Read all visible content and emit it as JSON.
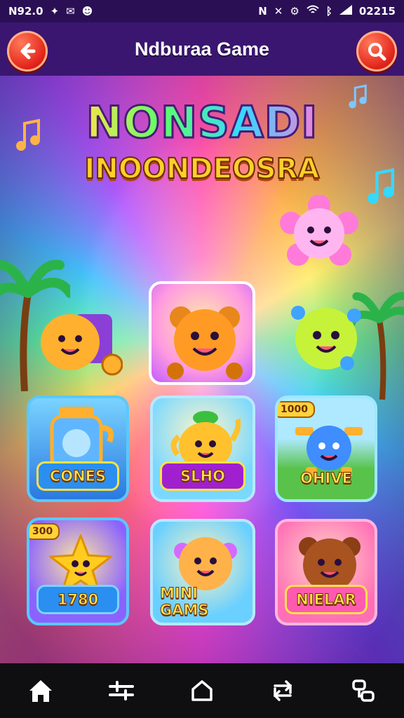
{
  "status_bar": {
    "time_left": "N92.0",
    "time_right": "02215"
  },
  "header": {
    "title": "Ndburaa Game"
  },
  "banner": {
    "line1": "NONSADI",
    "line2": "INOONDEOSRA"
  },
  "cards": [
    {
      "label": "CONES",
      "badge": ""
    },
    {
      "label": "SLHO",
      "badge": ""
    },
    {
      "label": "OHIVE",
      "badge": "1000"
    },
    {
      "label": "1780",
      "badge": "300"
    },
    {
      "label": "MINI GAMS",
      "badge": ""
    },
    {
      "label": "NIELAR",
      "badge": ""
    }
  ],
  "colors": {
    "header_bg": "#3a1670",
    "button_red": "#e2231a",
    "label_yellow": "#ffe14a",
    "nav_bg": "#0f0f12"
  },
  "nav": {
    "items": [
      "home-icon",
      "equalizer-icon",
      "house-outline-icon",
      "swap-icon",
      "link-icon"
    ]
  }
}
